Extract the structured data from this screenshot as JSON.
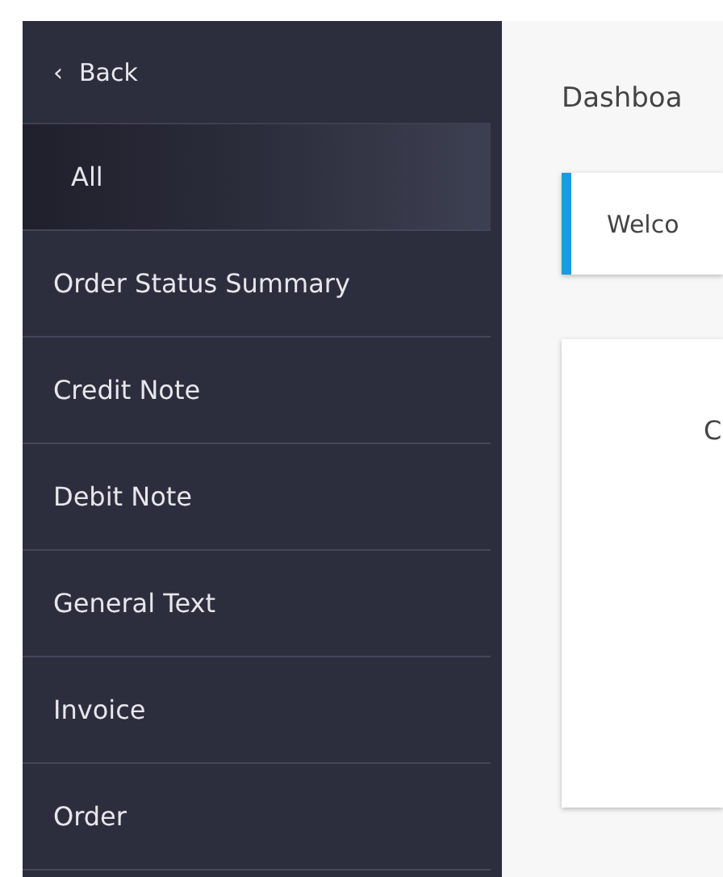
{
  "sidebar": {
    "back": {
      "icon": "‹",
      "label": "Back"
    },
    "items": [
      {
        "label": "All",
        "selected": true
      },
      {
        "label": "Order Status Summary",
        "selected": false
      },
      {
        "label": "Credit Note",
        "selected": false
      },
      {
        "label": "Debit Note",
        "selected": false
      },
      {
        "label": "General Text",
        "selected": false
      },
      {
        "label": "Invoice",
        "selected": false
      },
      {
        "label": "Order",
        "selected": false
      }
    ]
  },
  "main": {
    "title": "Dashboa",
    "welcome": "Welco",
    "card_text": "C"
  }
}
